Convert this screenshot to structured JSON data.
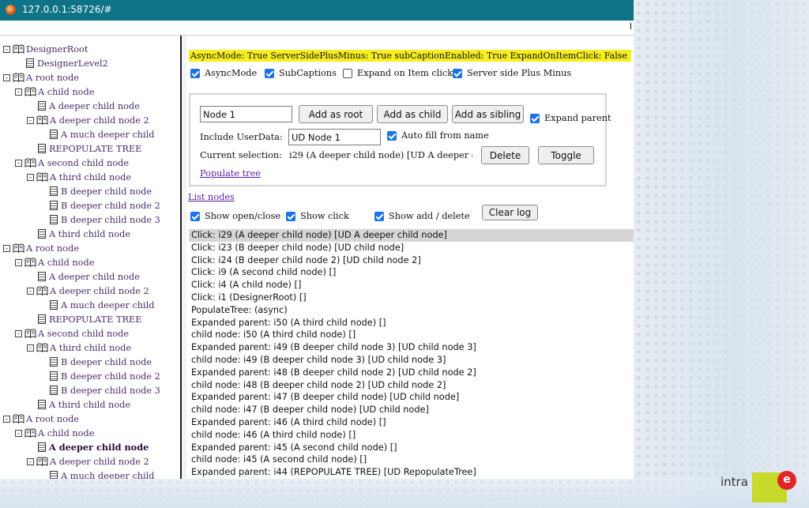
{
  "browser": {
    "title": "127.0.0.1:58726/#",
    "edge_char": "I"
  },
  "tree": [
    {
      "label": "DesignerRoot",
      "type": "folder",
      "pm": "-",
      "depth": 0
    },
    {
      "label": "DesignerLevel2",
      "type": "leaf",
      "depth": 1
    },
    {
      "label": "A root node",
      "type": "folder",
      "pm": "-",
      "depth": 0
    },
    {
      "label": "A child node",
      "type": "folder",
      "pm": "-",
      "depth": 1
    },
    {
      "label": "A deeper child node",
      "type": "leaf",
      "depth": 2
    },
    {
      "label": "A deeper child node 2",
      "type": "folder",
      "pm": "-",
      "depth": 2
    },
    {
      "label": "A much deeper child",
      "type": "leaf",
      "depth": 3
    },
    {
      "label": "REPOPULATE TREE",
      "type": "leaf",
      "depth": 2
    },
    {
      "label": "A second child node",
      "type": "folder",
      "pm": "-",
      "depth": 1
    },
    {
      "label": "A third child node",
      "type": "folder",
      "pm": "-",
      "depth": 2
    },
    {
      "label": "B deeper child node",
      "type": "leaf",
      "depth": 3
    },
    {
      "label": "B deeper child node 2",
      "type": "leaf",
      "depth": 3
    },
    {
      "label": "B deeper child node 3",
      "type": "leaf",
      "depth": 3
    },
    {
      "label": "A third child node",
      "type": "leaf",
      "depth": 2
    },
    {
      "label": "A root node",
      "type": "folder",
      "pm": "-",
      "depth": 0
    },
    {
      "label": "A child node",
      "type": "folder",
      "pm": "-",
      "depth": 1
    },
    {
      "label": "A deeper child node",
      "type": "leaf",
      "depth": 2
    },
    {
      "label": "A deeper child node 2",
      "type": "folder",
      "pm": "-",
      "depth": 2
    },
    {
      "label": "A much deeper child",
      "type": "leaf",
      "depth": 3
    },
    {
      "label": "REPOPULATE TREE",
      "type": "leaf",
      "depth": 2
    },
    {
      "label": "A second child node",
      "type": "folder",
      "pm": "-",
      "depth": 1
    },
    {
      "label": "A third child node",
      "type": "folder",
      "pm": "-",
      "depth": 2
    },
    {
      "label": "B deeper child node",
      "type": "leaf",
      "depth": 3
    },
    {
      "label": "B deeper child node 2",
      "type": "leaf",
      "depth": 3
    },
    {
      "label": "B deeper child node 3",
      "type": "leaf",
      "depth": 3
    },
    {
      "label": "A third child node",
      "type": "leaf",
      "depth": 2
    },
    {
      "label": "A root node",
      "type": "folder",
      "pm": "-",
      "depth": 0
    },
    {
      "label": "A child node",
      "type": "folder",
      "pm": "-",
      "depth": 1
    },
    {
      "label": "A deeper child node",
      "type": "leaf",
      "depth": 2,
      "selected": true
    },
    {
      "label": "A deeper child node 2",
      "type": "folder",
      "pm": "-",
      "depth": 2
    },
    {
      "label": "A much deeper child",
      "type": "leaf",
      "depth": 3
    }
  ],
  "status_line": "AsyncMode: True ServerSidePlusMinus: True subCaptionEnabled: True ExpandOnItemClick: False",
  "options": {
    "async_mode": {
      "label": "AsyncMode",
      "checked": true
    },
    "subcaptions": {
      "label": "SubCaptions",
      "checked": true
    },
    "expand_on_click": {
      "label": "Expand on Item click",
      "checked": false
    },
    "server_plus_minus": {
      "label": "Server side Plus Minus",
      "checked": true
    }
  },
  "panel": {
    "node_name_value": "Node 1",
    "add_root": "Add as root",
    "add_child": "Add as child",
    "add_sibling": "Add as sibling",
    "expand_parent": {
      "label": "Expand parent",
      "checked": true
    },
    "include_userdata_label": "Include UserData:",
    "userdata_value": "UD Node 1",
    "auto_fill": {
      "label": "Auto fill from name",
      "checked": true
    },
    "current_selection_label": "Current selection:",
    "current_selection_value": "i29 (A deeper child node) [UD A deeper child",
    "delete": "Delete",
    "toggle": "Toggle",
    "populate_tree": "Populate tree"
  },
  "list_nodes": "List nodes",
  "log_options": {
    "show_open_close": {
      "label": "Show open/close",
      "checked": true
    },
    "show_click": {
      "label": "Show click",
      "checked": true
    },
    "show_add_delete": {
      "label": "Show add / delete",
      "checked": true
    },
    "clear_log": "Clear log"
  },
  "log": [
    "Click: i29 (A deeper child node) [UD A deeper child node]",
    "Click: i23 (B deeper child node) [UD child node]",
    "Click: i24 (B deeper child node 2) [UD child node 2]",
    "Click: i9 (A second child node) []",
    "Click: i4 (A child node) []",
    "Click: i1 (DesignerRoot) []",
    "PopulateTree: (async)",
    "Expanded parent: i50 (A third child node) []",
    "child node: i50 (A third child node) []",
    "Expanded parent: i49 (B deeper child node 3) [UD child node 3]",
    "child node: i49 (B deeper child node 3) [UD child node 3]",
    "Expanded parent: i48 (B deeper child node 2) [UD child node 2]",
    "child node: i48 (B deeper child node 2) [UD child node 2]",
    "Expanded parent: i47 (B deeper child node) [UD child node]",
    "child node: i47 (B deeper child node) [UD child node]",
    "Expanded parent: i46 (A third child node) []",
    "child node: i46 (A third child node) []",
    "Expanded parent: i45 (A second child node) []",
    "child node: i45 (A second child node) []",
    "Expanded parent: i44 (REPOPULATE TREE) [UD RepopulateTree]"
  ],
  "logo": {
    "word": "intra",
    "badge": "e"
  }
}
